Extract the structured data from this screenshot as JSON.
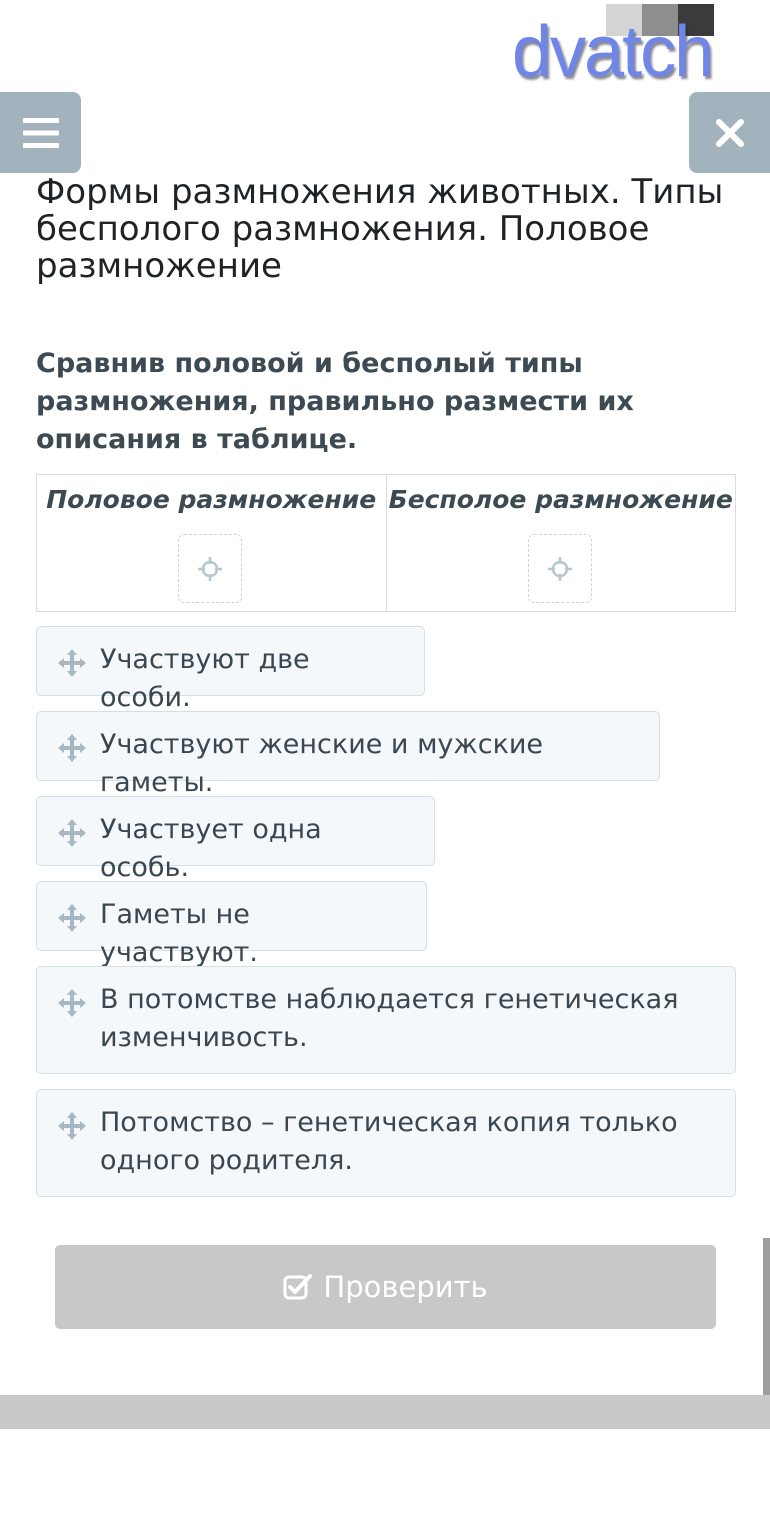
{
  "watermark": {
    "text": "dvatch"
  },
  "header": {
    "menu_icon": "hamburger-icon",
    "close_icon": "close-icon"
  },
  "lesson": {
    "title": "Формы размножения животных. Типы бесполого размножения. Половое размножение"
  },
  "task": {
    "question": "Сравнив половой и бесполый типы размножения, правильно размести их описания в таблице.",
    "columns": [
      {
        "header": "Половое размножение"
      },
      {
        "header": "Бесполое размножение"
      }
    ],
    "cards": [
      {
        "text": "Участвуют две особи."
      },
      {
        "text": "Участвуют женские и мужские гаметы."
      },
      {
        "text": "Участвует одна особь."
      },
      {
        "text": "Гаметы не участвуют."
      },
      {
        "text": "В потомстве наблюдается генетическая изменчивость."
      },
      {
        "text": "Потомство – генетическая копия только одного родителя."
      }
    ]
  },
  "actions": {
    "check_label": "Проверить",
    "check_enabled": false
  },
  "colors": {
    "header_button": "#a3b3bd",
    "card_background": "#f4f8fb",
    "card_border": "#d4e0e8",
    "disabled_button": "#c8c8c8"
  }
}
